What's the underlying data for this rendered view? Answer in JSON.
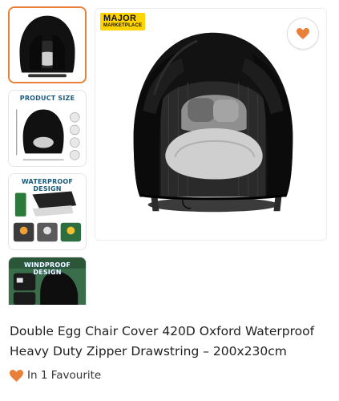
{
  "thumbnails": [
    {
      "id": "thumb-1",
      "caption": "",
      "selected": true
    },
    {
      "id": "thumb-2",
      "caption": "PRODUCT SIZE",
      "selected": false
    },
    {
      "id": "thumb-3",
      "caption": "WATERPROOF DESIGN",
      "selected": false
    },
    {
      "id": "thumb-4",
      "caption": "WINDPROOF DESIGN",
      "selected": false
    }
  ],
  "brand_badge": {
    "line1": "MAJOR",
    "line2": "MARKETPLACE"
  },
  "favourite_button": {
    "icon": "heart-icon",
    "color": "#e9803a"
  },
  "product": {
    "title": "Double Egg Chair Cover 420D Oxford Waterproof Heavy Duty Zipper Drawstring – 200x230cm",
    "favourites_text": "In 1 Favourite"
  },
  "colors": {
    "accent": "#e9803a",
    "badge": "#ffd400"
  }
}
